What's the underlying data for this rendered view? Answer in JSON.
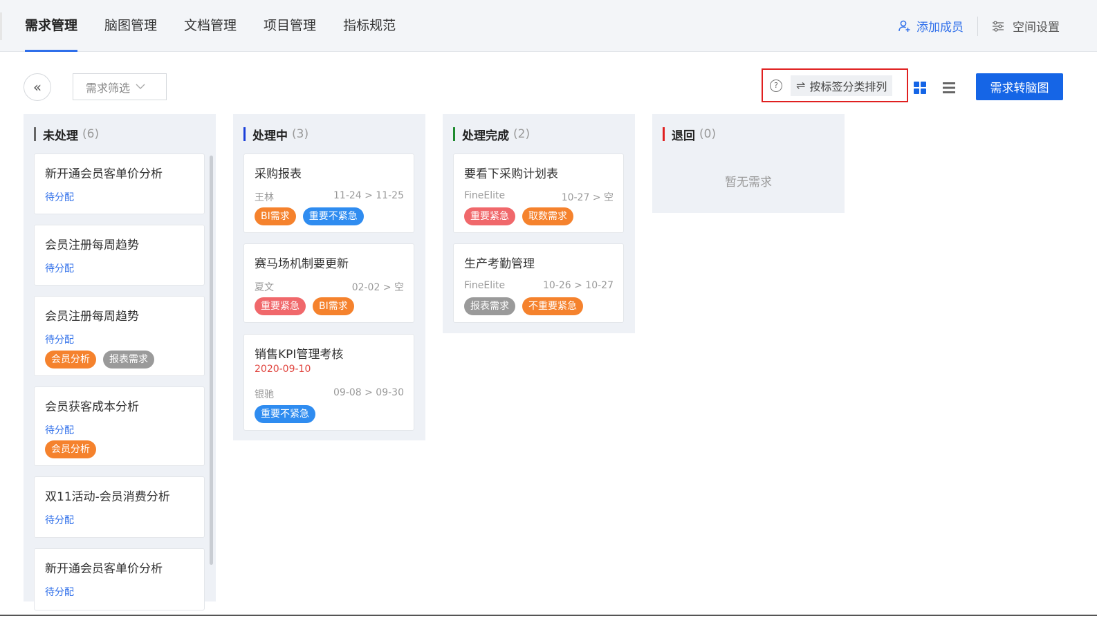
{
  "nav": {
    "tabs": [
      {
        "label": "需求管理",
        "active": true
      },
      {
        "label": "脑图管理"
      },
      {
        "label": "文档管理"
      },
      {
        "label": "项目管理"
      },
      {
        "label": "指标规范"
      }
    ],
    "add_member": "添加成员",
    "space_settings": "空间设置"
  },
  "toolbar": {
    "back_icon": "«",
    "filter_label": "需求筛选",
    "help_icon": "?",
    "sort_label": "按标签分类排列",
    "sort_icon": "⇌",
    "to_mindmap": "需求转脑图"
  },
  "colors": {
    "accent": "#2f6fea",
    "orange": "#f5822d",
    "blue": "#2f8cf0",
    "red": "#f0686b",
    "gray": "#9a9a9a"
  },
  "columns": [
    {
      "title": "未处理",
      "count": "(6)",
      "bar_color": "#666666",
      "cards": [
        {
          "title": "新开通会员客单价分析",
          "assign": "待分配"
        },
        {
          "title": "会员注册每周趋势",
          "assign": "待分配"
        },
        {
          "title": "会员注册每周趋势",
          "assign": "待分配",
          "tags": [
            "会员分析",
            "报表需求"
          ]
        },
        {
          "title": "会员获客成本分析",
          "assign": "待分配",
          "tags": [
            "会员分析"
          ]
        },
        {
          "title": "双11活动-会员消费分析",
          "assign": "待分配"
        },
        {
          "title": "新开通会员客单价分析",
          "assign": "待分配"
        }
      ]
    },
    {
      "title": "处理中",
      "count": "(3)",
      "bar_color": "#1a3fd9",
      "cards": [
        {
          "title": "采购报表",
          "owner": "王林",
          "range": "11-24 > 11-25",
          "tags": [
            "BI需求",
            "重要不紧急"
          ]
        },
        {
          "title": "赛马场机制要更新",
          "owner": "夏文",
          "range": "02-02 > 空",
          "tags": [
            "重要紧急",
            "BI需求"
          ]
        },
        {
          "title": "销售KPI管理考核",
          "due": "2020-09-10",
          "owner": "银驰",
          "range": "09-08 > 09-30",
          "tags": [
            "重要不紧急"
          ]
        }
      ]
    },
    {
      "title": "处理完成",
      "count": "(2)",
      "bar_color": "#1e8a2e",
      "cards": [
        {
          "title": "要看下采购计划表",
          "owner": "FineElite",
          "range": "10-27 > 空",
          "tags": [
            "重要紧急",
            "取数需求"
          ]
        },
        {
          "title": "生产考勤管理",
          "owner": "FineElite",
          "range": "10-26 > 10-27",
          "tags": [
            "报表需求",
            "不重要紧急"
          ]
        }
      ]
    },
    {
      "title": "退回",
      "count": "(0)",
      "bar_color": "#e02020",
      "empty_text": "暂无需求"
    }
  ]
}
